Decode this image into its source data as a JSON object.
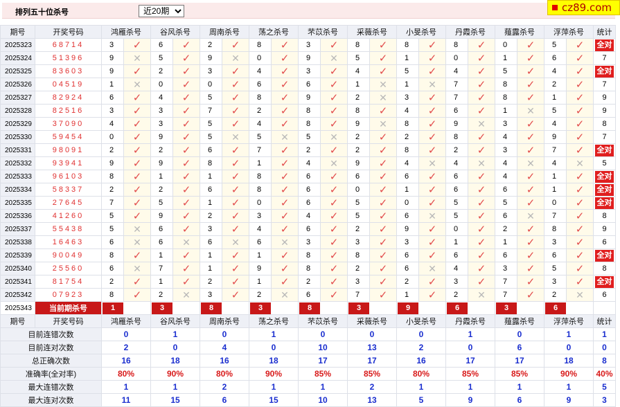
{
  "header": {
    "title": "排列五十位杀号",
    "period_select": "近20期",
    "period_options": [
      "近20期"
    ],
    "site_logo": "cz89.com"
  },
  "columns": {
    "period": "期号",
    "winning": "开奖号码",
    "experts": [
      "鸿雁杀号",
      "谷风杀号",
      "周南杀号",
      "荡之杀号",
      "芣苡杀号",
      "采薇杀号",
      "小旻杀号",
      "丹霞杀号",
      "薤露杀号",
      "浮萍杀号"
    ],
    "stat": "统计"
  },
  "all_correct_label": "全对",
  "rows": [
    {
      "period": "2025323",
      "win": "68714",
      "kill": [
        "3",
        "6",
        "2",
        "8",
        "3",
        "8",
        "8",
        "8",
        "0",
        "5"
      ],
      "ok": [
        1,
        1,
        1,
        1,
        1,
        1,
        1,
        1,
        1,
        1
      ],
      "stat": "全对"
    },
    {
      "period": "2025324",
      "win": "51396",
      "kill": [
        "9",
        "5",
        "9",
        "0",
        "9",
        "5",
        "1",
        "0",
        "1",
        "6"
      ],
      "ok": [
        0,
        1,
        0,
        1,
        0,
        1,
        1,
        1,
        1,
        1
      ],
      "stat": "7"
    },
    {
      "period": "2025325",
      "win": "83603",
      "kill": [
        "9",
        "2",
        "3",
        "4",
        "3",
        "4",
        "5",
        "4",
        "5",
        "4"
      ],
      "ok": [
        1,
        1,
        1,
        1,
        1,
        1,
        1,
        1,
        1,
        1
      ],
      "stat": "全对"
    },
    {
      "period": "2025326",
      "win": "04519",
      "kill": [
        "1",
        "0",
        "0",
        "6",
        "6",
        "1",
        "1",
        "7",
        "8",
        "2"
      ],
      "ok": [
        0,
        1,
        1,
        1,
        1,
        0,
        0,
        1,
        1,
        1
      ],
      "stat": "7"
    },
    {
      "period": "2025327",
      "win": "82924",
      "kill": [
        "6",
        "4",
        "5",
        "8",
        "9",
        "2",
        "3",
        "7",
        "8",
        "1"
      ],
      "ok": [
        1,
        1,
        1,
        1,
        1,
        0,
        1,
        1,
        1,
        1
      ],
      "stat": "9"
    },
    {
      "period": "2025328",
      "win": "82516",
      "kill": [
        "3",
        "3",
        "7",
        "2",
        "8",
        "8",
        "4",
        "6",
        "1",
        "5"
      ],
      "ok": [
        1,
        1,
        1,
        1,
        1,
        1,
        1,
        1,
        0,
        1
      ],
      "stat": "9"
    },
    {
      "period": "2025329",
      "win": "37090",
      "kill": [
        "4",
        "3",
        "5",
        "4",
        "8",
        "9",
        "8",
        "9",
        "3",
        "4"
      ],
      "ok": [
        1,
        1,
        1,
        1,
        1,
        0,
        1,
        0,
        1,
        1
      ],
      "stat": "8"
    },
    {
      "period": "2025330",
      "win": "59454",
      "kill": [
        "0",
        "9",
        "5",
        "5",
        "5",
        "2",
        "2",
        "8",
        "4",
        "9"
      ],
      "ok": [
        1,
        1,
        0,
        0,
        0,
        1,
        1,
        1,
        1,
        1
      ],
      "stat": "7"
    },
    {
      "period": "2025331",
      "win": "98091",
      "kill": [
        "2",
        "2",
        "6",
        "7",
        "2",
        "2",
        "8",
        "2",
        "3",
        "7"
      ],
      "ok": [
        1,
        1,
        1,
        1,
        1,
        1,
        1,
        1,
        1,
        1
      ],
      "stat": "全对"
    },
    {
      "period": "2025332",
      "win": "93941",
      "kill": [
        "9",
        "9",
        "8",
        "1",
        "4",
        "9",
        "4",
        "4",
        "4",
        "4"
      ],
      "ok": [
        1,
        1,
        1,
        1,
        0,
        1,
        0,
        0,
        0,
        0
      ],
      "stat": "5"
    },
    {
      "period": "2025333",
      "win": "96103",
      "kill": [
        "8",
        "1",
        "1",
        "8",
        "6",
        "6",
        "6",
        "6",
        "4",
        "1"
      ],
      "ok": [
        1,
        1,
        1,
        1,
        1,
        1,
        1,
        1,
        1,
        1
      ],
      "stat": "全对"
    },
    {
      "period": "2025334",
      "win": "58337",
      "kill": [
        "2",
        "2",
        "6",
        "8",
        "6",
        "0",
        "1",
        "6",
        "6",
        "1"
      ],
      "ok": [
        1,
        1,
        1,
        1,
        1,
        1,
        1,
        1,
        1,
        1
      ],
      "stat": "全对"
    },
    {
      "period": "2025335",
      "win": "27645",
      "kill": [
        "7",
        "5",
        "1",
        "0",
        "6",
        "5",
        "0",
        "5",
        "5",
        "0"
      ],
      "ok": [
        1,
        1,
        1,
        1,
        1,
        1,
        1,
        1,
        1,
        1
      ],
      "stat": "全对"
    },
    {
      "period": "2025336",
      "win": "41260",
      "kill": [
        "5",
        "9",
        "2",
        "3",
        "4",
        "5",
        "6",
        "5",
        "6",
        "7"
      ],
      "ok": [
        1,
        1,
        1,
        1,
        1,
        1,
        0,
        1,
        0,
        1
      ],
      "stat": "8"
    },
    {
      "period": "2025337",
      "win": "55438",
      "kill": [
        "5",
        "6",
        "3",
        "4",
        "6",
        "2",
        "9",
        "0",
        "2",
        "8"
      ],
      "ok": [
        0,
        1,
        1,
        1,
        1,
        1,
        1,
        1,
        1,
        1
      ],
      "stat": "9"
    },
    {
      "period": "2025338",
      "win": "16463",
      "kill": [
        "6",
        "6",
        "6",
        "6",
        "3",
        "3",
        "3",
        "1",
        "1",
        "3"
      ],
      "ok": [
        0,
        0,
        0,
        0,
        1,
        1,
        1,
        1,
        1,
        1
      ],
      "stat": "6"
    },
    {
      "period": "2025339",
      "win": "90049",
      "kill": [
        "8",
        "1",
        "1",
        "1",
        "8",
        "8",
        "6",
        "6",
        "6",
        "6"
      ],
      "ok": [
        1,
        1,
        1,
        1,
        1,
        1,
        1,
        1,
        1,
        1
      ],
      "stat": "全对"
    },
    {
      "period": "2025340",
      "win": "25560",
      "kill": [
        "6",
        "7",
        "1",
        "9",
        "8",
        "2",
        "6",
        "4",
        "3",
        "5"
      ],
      "ok": [
        0,
        1,
        1,
        1,
        1,
        1,
        0,
        1,
        1,
        1
      ],
      "stat": "8"
    },
    {
      "period": "2025341",
      "win": "81754",
      "kill": [
        "2",
        "1",
        "2",
        "1",
        "2",
        "3",
        "2",
        "3",
        "7",
        "3"
      ],
      "ok": [
        1,
        1,
        1,
        1,
        1,
        1,
        1,
        1,
        1,
        1
      ],
      "stat": "全对"
    },
    {
      "period": "2025342",
      "win": "07923",
      "kill": [
        "8",
        "2",
        "3",
        "2",
        "6",
        "7",
        "1",
        "2",
        "7",
        "2"
      ],
      "ok": [
        1,
        0,
        1,
        0,
        1,
        1,
        1,
        0,
        1,
        0
      ],
      "stat": "6"
    }
  ],
  "current": {
    "period": "2025343",
    "label": "当前期杀号",
    "kill": [
      "1",
      "3",
      "8",
      "3",
      "8",
      "3",
      "9",
      "6",
      "3",
      "6"
    ]
  },
  "stats": [
    {
      "label": "目前连错次数",
      "values": [
        "0",
        "1",
        "0",
        "1",
        "0",
        "0",
        "0",
        "1",
        "0",
        "1"
      ],
      "total": "1"
    },
    {
      "label": "目前连对次数",
      "values": [
        "2",
        "0",
        "4",
        "0",
        "10",
        "13",
        "2",
        "0",
        "6",
        "0"
      ],
      "total": "0"
    },
    {
      "label": "总正确次数",
      "values": [
        "16",
        "18",
        "16",
        "18",
        "17",
        "17",
        "16",
        "17",
        "17",
        "18"
      ],
      "total": "8"
    },
    {
      "label": "准确率(全对率)",
      "values": [
        "80%",
        "90%",
        "80%",
        "90%",
        "85%",
        "85%",
        "80%",
        "85%",
        "85%",
        "90%"
      ],
      "total": "40%",
      "red": true
    },
    {
      "label": "最大连错次数",
      "values": [
        "1",
        "1",
        "2",
        "1",
        "1",
        "2",
        "1",
        "1",
        "1",
        "1"
      ],
      "total": "5"
    },
    {
      "label": "最大连对次数",
      "values": [
        "11",
        "15",
        "6",
        "15",
        "10",
        "13",
        "5",
        "9",
        "6",
        "9"
      ],
      "total": "3"
    }
  ]
}
